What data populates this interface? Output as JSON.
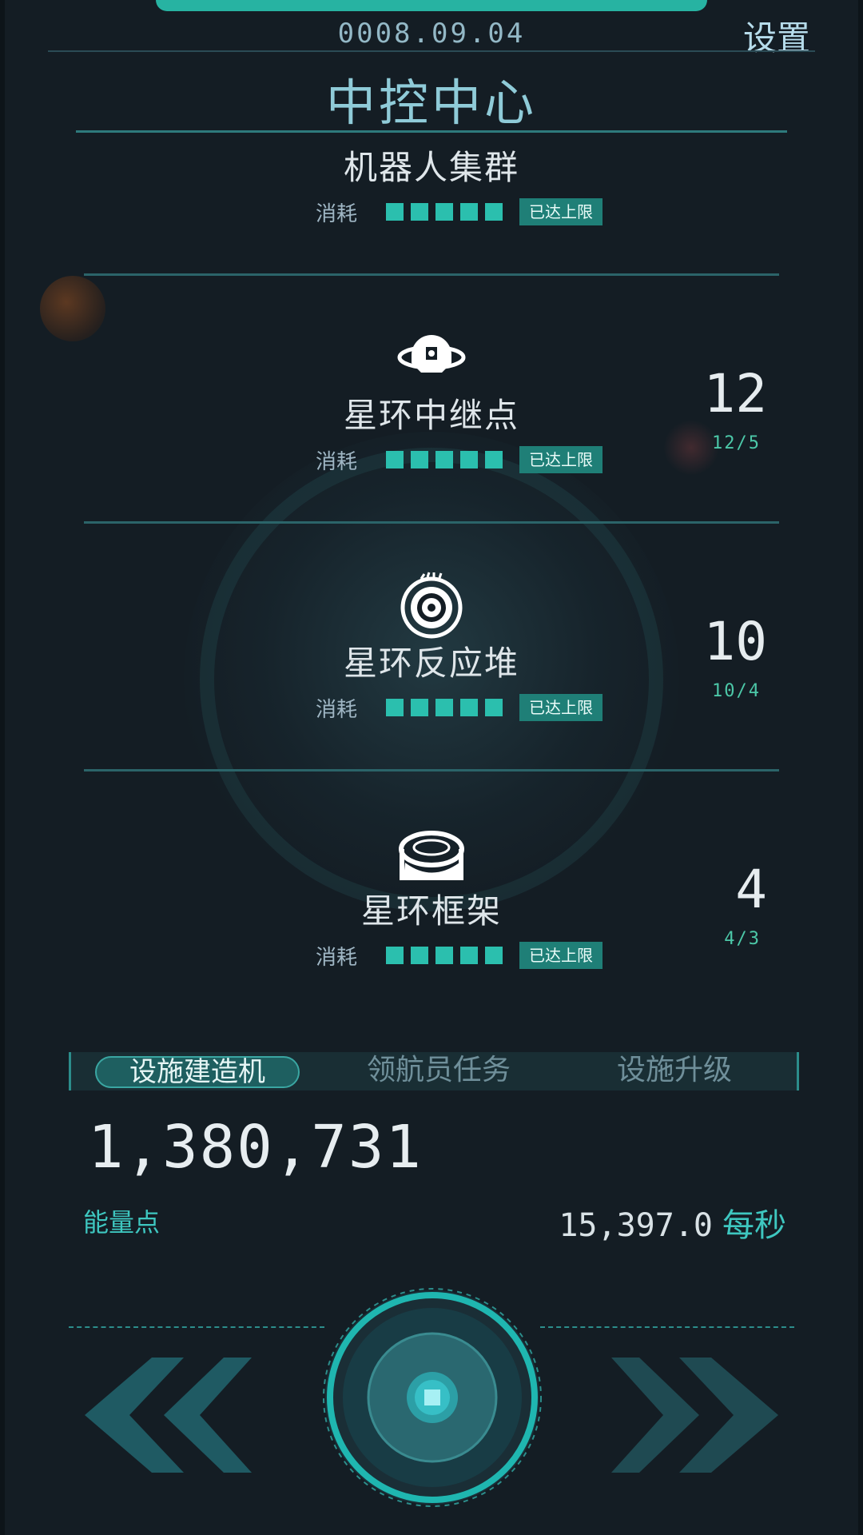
{
  "header": {
    "date": "0008.09.04",
    "settings_label": "设置",
    "title": "中控中心"
  },
  "items": [
    {
      "name": "机器人集群",
      "count": "",
      "ratio": "",
      "icon": "robot-cluster-icon",
      "cost_label": "消耗",
      "cost_level": 5,
      "badge": "已达上限"
    },
    {
      "name": "星环中继点",
      "count": "12",
      "ratio": "12/5",
      "icon": "relay-station-icon",
      "cost_label": "消耗",
      "cost_level": 5,
      "badge": "已达上限"
    },
    {
      "name": "星环反应堆",
      "count": "10",
      "ratio": "10/4",
      "icon": "reactor-icon",
      "cost_label": "消耗",
      "cost_level": 5,
      "badge": "已达上限"
    },
    {
      "name": "星环框架",
      "count": "4",
      "ratio": "4/3",
      "icon": "ring-frame-icon",
      "cost_label": "消耗",
      "cost_level": 5,
      "badge": "已达上限"
    }
  ],
  "tabs": [
    {
      "label": "设施建造机",
      "active": true
    },
    {
      "label": "领航员任务",
      "active": false
    },
    {
      "label": "设施升级",
      "active": false
    }
  ],
  "energy": {
    "value": "1,380,731",
    "label": "能量点",
    "rate_value": "15,397.0",
    "rate_unit": "每秒"
  },
  "colors": {
    "accent": "#2bbfae",
    "badge": "#1f7f77",
    "background": "#141d24"
  }
}
